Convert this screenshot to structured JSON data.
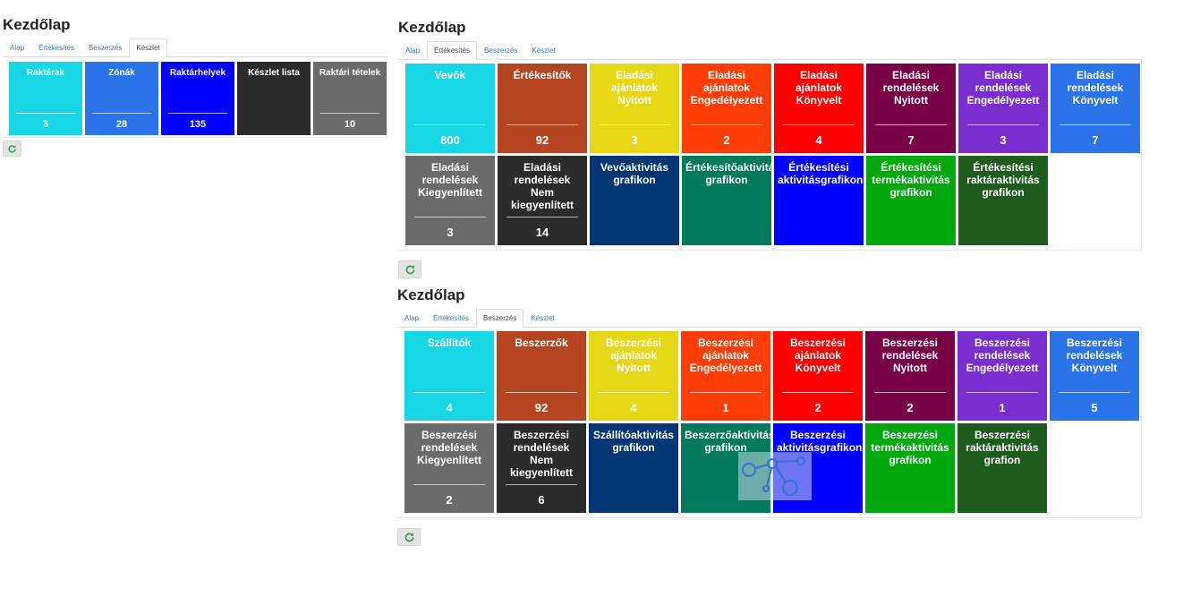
{
  "warehouse_panel": {
    "title": "Kezdőlap",
    "tabs": [
      "Alap",
      "Értékesítés",
      "Beszerzés",
      "Készlet"
    ],
    "active_tab": 3,
    "tiles": [
      {
        "label": "Raktárak",
        "value": "3",
        "color": "#17d7e6"
      },
      {
        "label": "Zónák",
        "value": "28",
        "color": "#2b73e8"
      },
      {
        "label": "Raktárhelyek",
        "value": "135",
        "color": "#0000ff"
      },
      {
        "label": "Készlet lista",
        "value": "",
        "color": "#2b2b2b"
      },
      {
        "label": "Raktári tételek",
        "value": "10",
        "color": "#6c6b6b"
      }
    ]
  },
  "sales_panel": {
    "title": "Kezdőlap",
    "tabs": [
      "Alap",
      "Értékesítés",
      "Beszerzés",
      "Készlet"
    ],
    "active_tab": 1,
    "tiles": [
      {
        "label": "Vevők",
        "value": "800",
        "color": "#17d7e6"
      },
      {
        "label": "Értékesítők",
        "value": "92",
        "color": "#b44520"
      },
      {
        "label": "Eladási ajánlatok Nyitott",
        "value": "3",
        "color": "#e6d816"
      },
      {
        "label": "Eladási ajánlatok Engedélyezett",
        "value": "2",
        "color": "#ff3d06"
      },
      {
        "label": "Eladási ajánlatok Könyvelt",
        "value": "4",
        "color": "#ff0000"
      },
      {
        "label": "Eladási rendelések Nyitott",
        "value": "7",
        "color": "#780046"
      },
      {
        "label": "Eladási rendelések Engedélyezett",
        "value": "3",
        "color": "#7a2ed0"
      },
      {
        "label": "Eladási rendelések Könyvelt",
        "value": "7",
        "color": "#2b73e8"
      },
      {
        "label": "Eladási rendelések Kiegyenlített",
        "value": "3",
        "color": "#6c6b6b"
      },
      {
        "label": "Eladási rendelések Nem kiegyenlített",
        "value": "14",
        "color": "#2b2b2b"
      },
      {
        "label": "Vevőaktivitás grafikon",
        "value": "",
        "color": "#013674"
      },
      {
        "label": "Értékesítőaktivitás grafikon",
        "value": "",
        "color": "#007a5a"
      },
      {
        "label": "Értékesítési aktivitásgrafikon",
        "value": "",
        "color": "#0000ff"
      },
      {
        "label": "Értékesítési termékaktivitás grafikon",
        "value": "",
        "color": "#00a80e"
      },
      {
        "label": "Értékesítési raktáraktivitás grafikon",
        "value": "",
        "color": "#1e5b1e"
      }
    ]
  },
  "purchase_panel": {
    "title": "Kezdőlap",
    "tabs": [
      "Alap",
      "Értékesítés",
      "Beszerzés",
      "Készlet"
    ],
    "active_tab": 2,
    "tiles": [
      {
        "label": "Szállítók",
        "value": "4",
        "color": "#17d7e6"
      },
      {
        "label": "Beszerzők",
        "value": "92",
        "color": "#b44520"
      },
      {
        "label": "Beszerzési ajánlatok Nyitott",
        "value": "4",
        "color": "#e6d816"
      },
      {
        "label": "Beszerzési ajánlatok Engedélyezett",
        "value": "1",
        "color": "#ff3d06"
      },
      {
        "label": "Beszerzési ajánlatok Könyvelt",
        "value": "2",
        "color": "#ff0000"
      },
      {
        "label": "Beszerzési rendelések Nyitott",
        "value": "2",
        "color": "#780046"
      },
      {
        "label": "Beszerzési rendelések Engedélyezett",
        "value": "1",
        "color": "#7a2ed0"
      },
      {
        "label": "Beszerzési rendelések Könyvelt",
        "value": "5",
        "color": "#2b73e8"
      },
      {
        "label": "Beszerzési rendelések Kiegyenlített",
        "value": "2",
        "color": "#6c6b6b"
      },
      {
        "label": "Beszerzési rendelések Nem kiegyenlített",
        "value": "6",
        "color": "#2b2b2b"
      },
      {
        "label": "Szállítóaktivitás grafikon",
        "value": "",
        "color": "#013674"
      },
      {
        "label": "Beszerzőaktivitás grafikon",
        "value": "",
        "color": "#007a5a"
      },
      {
        "label": "Beszerzési aktivitásgrafikon",
        "value": "",
        "color": "#0000ff"
      },
      {
        "label": "Beszerzési termékaktivitás grafikon",
        "value": "",
        "color": "#00a80e"
      },
      {
        "label": "Beszerzési raktáraktivitás grafion",
        "value": "",
        "color": "#1e5b1e"
      }
    ]
  },
  "icons": {
    "refresh": "refresh-icon",
    "overlay": "share-nodes-icon"
  },
  "accent": {
    "refresh_icon_color": "#2e9e4f"
  }
}
